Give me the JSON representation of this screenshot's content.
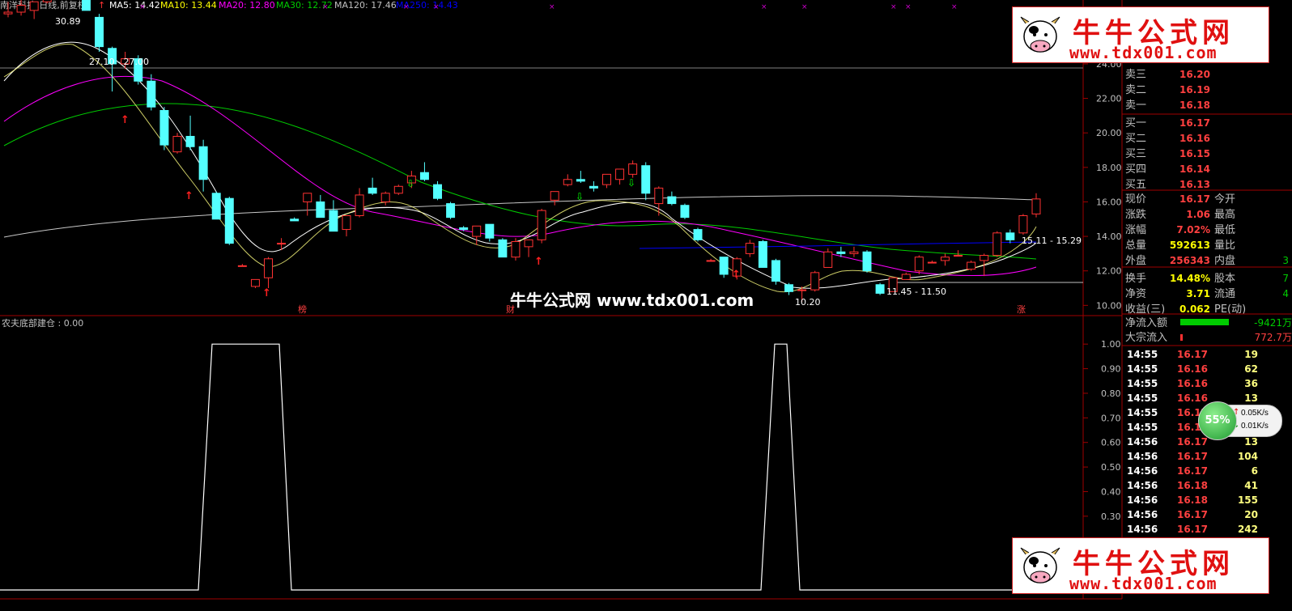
{
  "header": {
    "stock": "南洋科技(日线,前复权)",
    "ma5": "MA5: 14.42",
    "ma10": "MA10: 13.44",
    "ma20": "MA20: 12.80",
    "ma30": "MA30: 12.72",
    "ma120": "MA120: 17.46",
    "ma250": "MA250: 14.43"
  },
  "colors": {
    "up": "#ff3232",
    "down": "#54ffff",
    "ma5": "#ffffff",
    "ma10": "#ffff00",
    "ma20": "#ff00ff",
    "ma30": "#00cc00",
    "ma120": "#c0c0c0",
    "ma250": "#0000ff"
  },
  "chart_annotations": {
    "high_label": "30.89",
    "range1": "27.10 - 27.00",
    "range2": "15.11 - 15.29",
    "range3": "11.45 - 11.50",
    "low_label": "10.20",
    "marker_bang": "榜",
    "marker_cai": "财",
    "marker_zhang": "涨"
  },
  "price_axis": [
    "26.00",
    "24.00",
    "22.00",
    "20.00",
    "18.00",
    "16.00",
    "14.00",
    "12.00",
    "10.00"
  ],
  "indicator": {
    "title": "农夫底部建仓 : 0.00",
    "axis": [
      "1.00",
      "0.90",
      "0.80",
      "0.70",
      "0.60",
      "0.50",
      "0.40",
      "0.30",
      "0.20",
      "0.10"
    ]
  },
  "chart_data": [
    {
      "type": "candlestick",
      "title": "南洋科技(日线,前复权)",
      "ylim": [
        9.5,
        27.0
      ],
      "candles": [
        {
          "o": 26.9,
          "h": 27.6,
          "l": 26.7,
          "c": 27.0
        },
        {
          "o": 27.0,
          "h": 27.8,
          "l": 26.8,
          "c": 27.4
        },
        {
          "o": 27.1,
          "h": 27.6,
          "l": 26.6,
          "c": 27.6
        },
        {
          "o": 27.6,
          "h": 30.89,
          "l": 27.5,
          "c": 30.5
        },
        {
          "o": 29.8,
          "h": 30.2,
          "l": 29.0,
          "c": 29.3
        },
        {
          "o": 29.2,
          "h": 29.5,
          "l": 27.8,
          "c": 28.6
        },
        {
          "o": 28.3,
          "h": 28.6,
          "l": 27.1,
          "c": 27.1
        },
        {
          "o": 26.7,
          "h": 26.9,
          "l": 24.7,
          "c": 25.0
        },
        {
          "o": 24.9,
          "h": 25.0,
          "l": 22.4,
          "c": 24.0
        },
        {
          "o": 24.0,
          "h": 24.7,
          "l": 23.7,
          "c": 24.3
        },
        {
          "o": 24.3,
          "h": 24.5,
          "l": 22.8,
          "c": 23.0
        },
        {
          "o": 23.0,
          "h": 23.4,
          "l": 21.3,
          "c": 21.5
        },
        {
          "o": 21.3,
          "h": 21.5,
          "l": 19.0,
          "c": 19.3
        },
        {
          "o": 18.9,
          "h": 20.0,
          "l": 18.8,
          "c": 19.8
        },
        {
          "o": 19.8,
          "h": 21.0,
          "l": 19.0,
          "c": 19.2
        },
        {
          "o": 19.2,
          "h": 19.6,
          "l": 16.6,
          "c": 17.3
        },
        {
          "o": 16.5,
          "h": 16.6,
          "l": 15.0,
          "c": 15.0
        },
        {
          "o": 16.2,
          "h": 16.3,
          "l": 13.5,
          "c": 13.6
        },
        {
          "o": 12.3,
          "h": 12.4,
          "l": 12.3,
          "c": 12.3
        },
        {
          "o": 11.1,
          "h": 11.5,
          "l": 11.0,
          "c": 11.5
        },
        {
          "o": 11.6,
          "h": 12.8,
          "l": 11.0,
          "c": 12.7
        },
        {
          "o": 13.6,
          "h": 13.9,
          "l": 13.2,
          "c": 13.6
        },
        {
          "o": 15.0,
          "h": 15.1,
          "l": 14.9,
          "c": 14.9
        },
        {
          "o": 16.0,
          "h": 16.5,
          "l": 15.2,
          "c": 16.5
        },
        {
          "o": 16.0,
          "h": 16.4,
          "l": 15.1,
          "c": 15.1
        },
        {
          "o": 15.5,
          "h": 16.1,
          "l": 14.3,
          "c": 14.3
        },
        {
          "o": 14.4,
          "h": 15.0,
          "l": 14.0,
          "c": 15.2
        },
        {
          "o": 15.2,
          "h": 16.8,
          "l": 15.1,
          "c": 16.4
        },
        {
          "o": 16.8,
          "h": 17.4,
          "l": 16.4,
          "c": 16.5
        },
        {
          "o": 16.0,
          "h": 16.6,
          "l": 15.8,
          "c": 16.5
        },
        {
          "o": 16.5,
          "h": 17.0,
          "l": 16.4,
          "c": 16.9
        },
        {
          "o": 17.1,
          "h": 17.8,
          "l": 16.8,
          "c": 17.5
        },
        {
          "o": 17.7,
          "h": 18.3,
          "l": 17.2,
          "c": 17.3
        },
        {
          "o": 17.0,
          "h": 17.2,
          "l": 16.1,
          "c": 16.2
        },
        {
          "o": 15.9,
          "h": 16.0,
          "l": 15.0,
          "c": 15.1
        },
        {
          "o": 14.5,
          "h": 14.6,
          "l": 14.3,
          "c": 14.4
        },
        {
          "o": 14.0,
          "h": 14.6,
          "l": 13.5,
          "c": 14.6
        },
        {
          "o": 14.7,
          "h": 14.7,
          "l": 13.7,
          "c": 13.9
        },
        {
          "o": 13.8,
          "h": 13.9,
          "l": 12.8,
          "c": 12.8
        },
        {
          "o": 12.8,
          "h": 13.9,
          "l": 12.6,
          "c": 13.7
        },
        {
          "o": 13.4,
          "h": 13.8,
          "l": 12.8,
          "c": 13.8
        },
        {
          "o": 13.8,
          "h": 15.6,
          "l": 13.6,
          "c": 15.5
        },
        {
          "o": 16.1,
          "h": 16.6,
          "l": 15.8,
          "c": 16.6
        },
        {
          "o": 17.0,
          "h": 17.6,
          "l": 16.9,
          "c": 17.3
        },
        {
          "o": 17.3,
          "h": 17.8,
          "l": 17.1,
          "c": 17.2
        },
        {
          "o": 16.9,
          "h": 17.2,
          "l": 16.6,
          "c": 16.8
        },
        {
          "o": 17.0,
          "h": 17.6,
          "l": 16.8,
          "c": 17.6
        },
        {
          "o": 17.3,
          "h": 17.9,
          "l": 17.0,
          "c": 17.9
        },
        {
          "o": 17.6,
          "h": 18.4,
          "l": 17.4,
          "c": 18.2
        },
        {
          "o": 18.1,
          "h": 18.3,
          "l": 16.1,
          "c": 16.5
        },
        {
          "o": 15.9,
          "h": 16.9,
          "l": 15.2,
          "c": 16.8
        },
        {
          "o": 16.3,
          "h": 16.6,
          "l": 15.8,
          "c": 15.9
        },
        {
          "o": 15.8,
          "h": 15.9,
          "l": 15.0,
          "c": 15.1
        },
        {
          "o": 14.4,
          "h": 14.5,
          "l": 13.7,
          "c": 13.8
        },
        {
          "o": 12.6,
          "h": 12.7,
          "l": 12.6,
          "c": 12.6
        },
        {
          "o": 12.8,
          "h": 12.8,
          "l": 11.6,
          "c": 11.8
        },
        {
          "o": 11.7,
          "h": 12.8,
          "l": 11.5,
          "c": 12.7
        },
        {
          "o": 13.0,
          "h": 13.8,
          "l": 12.8,
          "c": 13.6
        },
        {
          "o": 13.7,
          "h": 13.8,
          "l": 12.2,
          "c": 12.2
        },
        {
          "o": 12.6,
          "h": 12.7,
          "l": 11.2,
          "c": 11.4
        },
        {
          "o": 11.2,
          "h": 11.3,
          "l": 10.6,
          "c": 10.8
        },
        {
          "o": 10.9,
          "h": 11.1,
          "l": 10.2,
          "c": 10.9
        },
        {
          "o": 10.9,
          "h": 12.0,
          "l": 10.8,
          "c": 11.9
        },
        {
          "o": 12.2,
          "h": 13.3,
          "l": 12.2,
          "c": 13.1
        },
        {
          "o": 13.1,
          "h": 13.4,
          "l": 12.8,
          "c": 13.0
        },
        {
          "o": 13.0,
          "h": 13.4,
          "l": 12.8,
          "c": 13.1
        },
        {
          "o": 13.1,
          "h": 13.2,
          "l": 11.9,
          "c": 12.0
        },
        {
          "o": 11.2,
          "h": 11.3,
          "l": 10.6,
          "c": 10.7
        },
        {
          "o": 10.8,
          "h": 11.6,
          "l": 10.8,
          "c": 11.6
        },
        {
          "o": 11.5,
          "h": 11.9,
          "l": 11.5,
          "c": 11.8
        },
        {
          "o": 12.0,
          "h": 12.9,
          "l": 11.8,
          "c": 12.8
        },
        {
          "o": 12.5,
          "h": 12.6,
          "l": 12.5,
          "c": 12.5
        },
        {
          "o": 12.6,
          "h": 13.0,
          "l": 12.3,
          "c": 12.8
        },
        {
          "o": 12.9,
          "h": 13.2,
          "l": 12.9,
          "c": 12.9
        },
        {
          "o": 12.1,
          "h": 12.6,
          "l": 12.0,
          "c": 12.5
        },
        {
          "o": 12.6,
          "h": 13.0,
          "l": 11.7,
          "c": 12.9
        },
        {
          "o": 12.9,
          "h": 14.3,
          "l": 12.8,
          "c": 14.2
        },
        {
          "o": 14.2,
          "h": 14.4,
          "l": 13.6,
          "c": 13.8
        },
        {
          "o": 14.2,
          "h": 15.3,
          "l": 14.1,
          "c": 15.2
        },
        {
          "o": 15.3,
          "h": 16.5,
          "l": 15.1,
          "c": 16.17
        }
      ]
    },
    {
      "type": "line",
      "title": "农夫底部建仓",
      "ylim": [
        0,
        1.05
      ],
      "x": [
        0,
        245,
        262,
        345,
        360,
        940,
        957,
        972,
        988,
        1250
      ],
      "y": [
        0,
        0,
        1,
        1,
        0,
        0,
        1,
        1,
        0,
        0
      ]
    }
  ],
  "quotes": {
    "sell": [
      {
        "label": "卖三",
        "price": "16.20"
      },
      {
        "label": "卖二",
        "price": "16.19"
      },
      {
        "label": "卖一",
        "price": "16.18"
      }
    ],
    "buy": [
      {
        "label": "买一",
        "price": "16.17"
      },
      {
        "label": "买二",
        "price": "16.16"
      },
      {
        "label": "买三",
        "price": "16.15"
      },
      {
        "label": "买四",
        "price": "16.14"
      },
      {
        "label": "买五",
        "price": "16.13"
      }
    ],
    "info": [
      {
        "l1": "现价",
        "v1": "16.17",
        "l2": "今开",
        "v2": "",
        "color": "#ff4040"
      },
      {
        "l1": "涨跌",
        "v1": "1.06",
        "l2": "最高",
        "v2": "",
        "color": "#ff4040"
      },
      {
        "l1": "涨幅",
        "v1": "7.02%",
        "l2": "最低",
        "v2": "",
        "color": "#ff4040"
      },
      {
        "l1": "总量",
        "v1": "592613",
        "l2": "量比",
        "v2": "",
        "color": "#ffff00"
      },
      {
        "l1": "外盘",
        "v1": "256343",
        "l2": "内盘",
        "v2": "3",
        "color": "#ff4040"
      },
      {
        "l1": "换手",
        "v1": "14.48%",
        "l2": "股本",
        "v2": "7",
        "color": "#ffff00"
      },
      {
        "l1": "净资",
        "v1": "3.71",
        "l2": "流通",
        "v2": "4",
        "color": "#ffff00"
      },
      {
        "l1": "收益(三)",
        "v1": "0.062",
        "l2": "PE(动)",
        "v2": "",
        "color": "#ffff00"
      }
    ],
    "netflow_label": "净流入额",
    "netflow_value": "-9421万",
    "block_label": "大宗流入",
    "block_value": "772.7万",
    "ticks": [
      {
        "t": "14:55",
        "p": "16.17",
        "v": "19",
        "c": "#ff4040"
      },
      {
        "t": "14:55",
        "p": "16.16",
        "v": "62",
        "c": "#ff4040"
      },
      {
        "t": "14:55",
        "p": "16.16",
        "v": "36",
        "c": "#ff4040"
      },
      {
        "t": "14:55",
        "p": "16.16",
        "v": "13",
        "c": "#ff4040"
      },
      {
        "t": "14:55",
        "p": "16.17",
        "v": "",
        "c": "#ff4040"
      },
      {
        "t": "14:55",
        "p": "16.17",
        "v": "",
        "c": "#ff4040"
      },
      {
        "t": "14:56",
        "p": "16.17",
        "v": "13",
        "c": "#ff4040"
      },
      {
        "t": "14:56",
        "p": "16.17",
        "v": "104",
        "c": "#ff4040"
      },
      {
        "t": "14:56",
        "p": "16.17",
        "v": "6",
        "c": "#ff4040"
      },
      {
        "t": "14:56",
        "p": "16.18",
        "v": "41",
        "c": "#ff4040"
      },
      {
        "t": "14:56",
        "p": "16.18",
        "v": "155",
        "c": "#ff4040"
      },
      {
        "t": "14:56",
        "p": "16.17",
        "v": "20",
        "c": "#ff4040"
      },
      {
        "t": "14:56",
        "p": "16.17",
        "v": "242",
        "c": "#ff4040"
      }
    ]
  },
  "speed_widget": {
    "percent": "55%",
    "up": "0.05K/s",
    "down": "0.01K/s"
  },
  "watermark": "牛牛公式网 www.tdx001.com",
  "banner": {
    "title": "牛牛公式网",
    "url": "www.tdx001.com"
  }
}
